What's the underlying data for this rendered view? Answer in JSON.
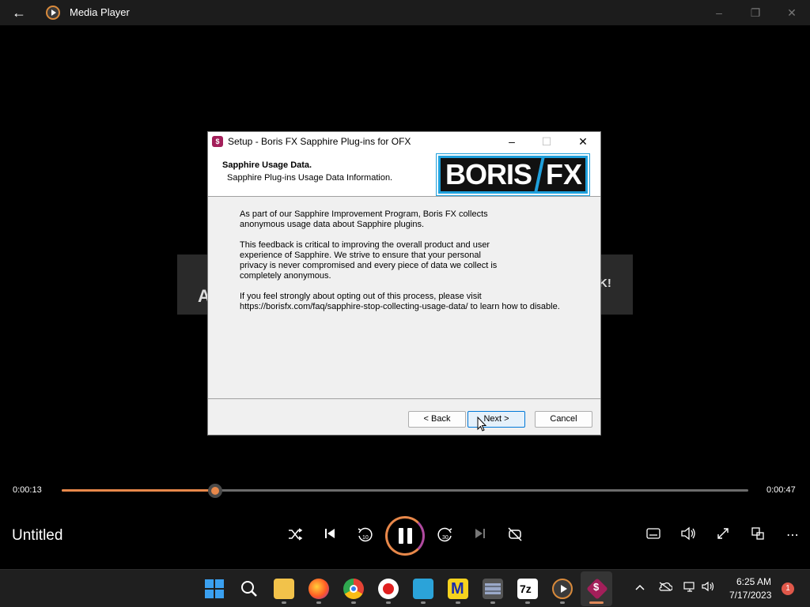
{
  "titlebar": {
    "back_icon": "arrow-left-icon",
    "app_title": "Media Player",
    "minimize": "–",
    "maximize": "❐",
    "close": "✕"
  },
  "video": {
    "left_text": "A",
    "right_text": "K!"
  },
  "dialog": {
    "title": "Setup - Boris FX Sapphire Plug-ins for OFX",
    "minimize": "–",
    "maximize": "☐",
    "close": "✕",
    "header_title": "Sapphire Usage Data.",
    "header_subtitle": "Sapphire Plug-ins Usage Data Information.",
    "logo_left": "BORIS",
    "logo_right": "FX",
    "body": [
      "As part of our Sapphire Improvement Program, Boris FX collects\nanonymous usage data about Sapphire plugins.",
      "This feedback is critical to improving the overall product and user\nexperience of Sapphire. We strive to ensure that your personal\nprivacy is never compromised and every piece of data we collect is\ncompletely anonymous.",
      "If you feel strongly about opting out of this process, please visit\nhttps://borisfx.com/faq/sapphire-stop-collecting-usage-data/ to learn how to disable."
    ],
    "back_button": "< Back",
    "next_button": "Next >",
    "cancel_button": "Cancel"
  },
  "player": {
    "current_time": "0:00:13",
    "total_time": "0:00:47",
    "progress": 0.224,
    "title": "Untitled",
    "controls": {
      "shuffle": "⤨",
      "previous": "⏮",
      "rewind": "↺",
      "rewind_label": "10",
      "forward": "↻",
      "forward_label": "30",
      "next": "⏭",
      "repeat": "🔁",
      "captions": "▭",
      "volume": "🔊",
      "fullscreen": "⤢",
      "miniplayer": "⧉",
      "more": "⋯"
    }
  },
  "taskbar": {
    "clock_time": "6:25 AM",
    "clock_date": "7/17/2023",
    "notification_count": "1",
    "tray": {
      "chevron": "^",
      "network": "☁",
      "display": "▭",
      "volume": "🔊"
    }
  }
}
